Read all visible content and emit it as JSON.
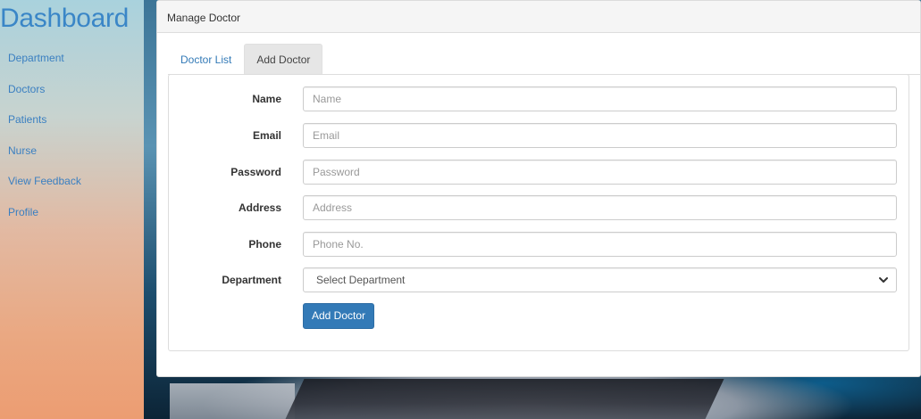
{
  "sidebar": {
    "brand": "Dashboard",
    "items": [
      {
        "label": "Department"
      },
      {
        "label": "Doctors"
      },
      {
        "label": "Patients"
      },
      {
        "label": "Nurse"
      },
      {
        "label": "View Feedback"
      },
      {
        "label": "Profile"
      }
    ]
  },
  "panel": {
    "heading": "Manage Doctor",
    "tabs": [
      {
        "label": "Doctor List",
        "active": false
      },
      {
        "label": "Add Doctor",
        "active": true
      }
    ]
  },
  "form": {
    "fields": [
      {
        "label": "Name",
        "placeholder": "Name",
        "value": ""
      },
      {
        "label": "Email",
        "placeholder": "Email",
        "value": ""
      },
      {
        "label": "Password",
        "placeholder": "Password",
        "value": ""
      },
      {
        "label": "Address",
        "placeholder": "Address",
        "value": ""
      },
      {
        "label": "Phone",
        "placeholder": "Phone No.",
        "value": ""
      }
    ],
    "department": {
      "label": "Department",
      "selected": "Select Department"
    },
    "submit_label": "Add Doctor"
  },
  "colors": {
    "brand": "#3a86c7",
    "link": "#337ab7",
    "primary_button": "#337ab7"
  },
  "icons": {
    "select_arrow": "chevron-down-icon"
  }
}
